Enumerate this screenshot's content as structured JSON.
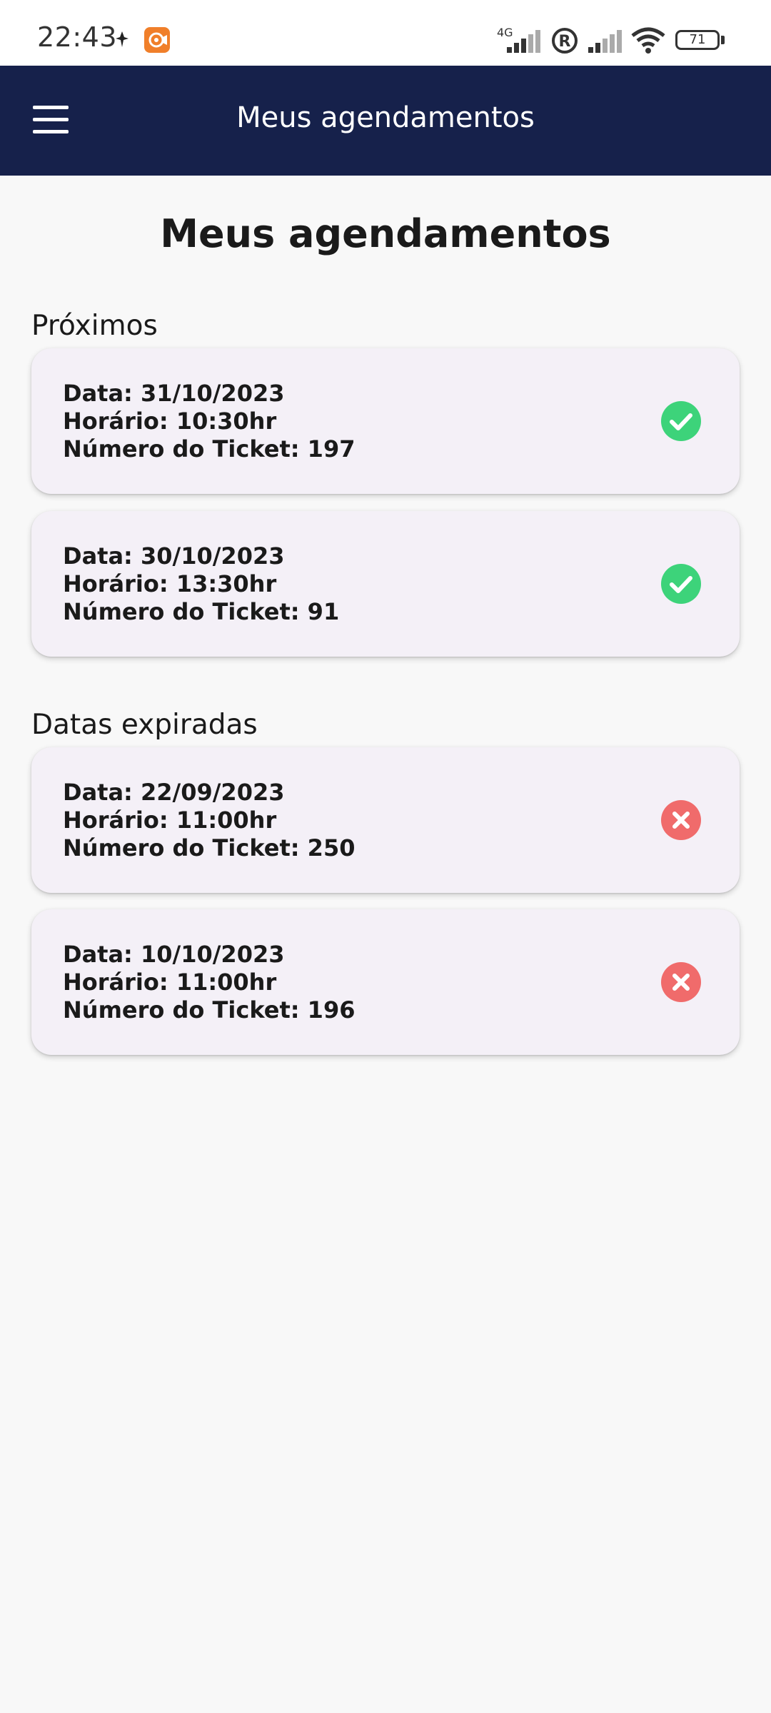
{
  "status_bar": {
    "time": "22:43",
    "network_type": "4G",
    "battery": "71"
  },
  "app_bar": {
    "title": "Meus agendamentos",
    "menu_icon": "hamburger-menu-icon"
  },
  "page": {
    "title": "Meus agendamentos"
  },
  "sections": [
    {
      "label": "Próximos",
      "items": [
        {
          "date": "Data: 31/10/2023",
          "time": "Horário: 10:30hr",
          "ticket": "Número do Ticket: 197",
          "status": "confirmed"
        },
        {
          "date": "Data: 30/10/2023",
          "time": "Horário: 13:30hr",
          "ticket": "Número do Ticket: 91",
          "status": "confirmed"
        }
      ]
    },
    {
      "label": "Datas expiradas",
      "items": [
        {
          "date": "Data: 22/09/2023",
          "time": "Horário: 11:00hr",
          "ticket": "Número do Ticket: 250",
          "status": "expired"
        },
        {
          "date": "Data: 10/10/2023",
          "time": "Horário: 11:00hr",
          "ticket": "Número do Ticket: 196",
          "status": "expired"
        }
      ]
    }
  ],
  "colors": {
    "app_bar": "#16214b",
    "confirmed": "#3dd37a",
    "expired": "#f06b6b",
    "card": "#f4f0f7",
    "background": "#f8f8f8"
  }
}
